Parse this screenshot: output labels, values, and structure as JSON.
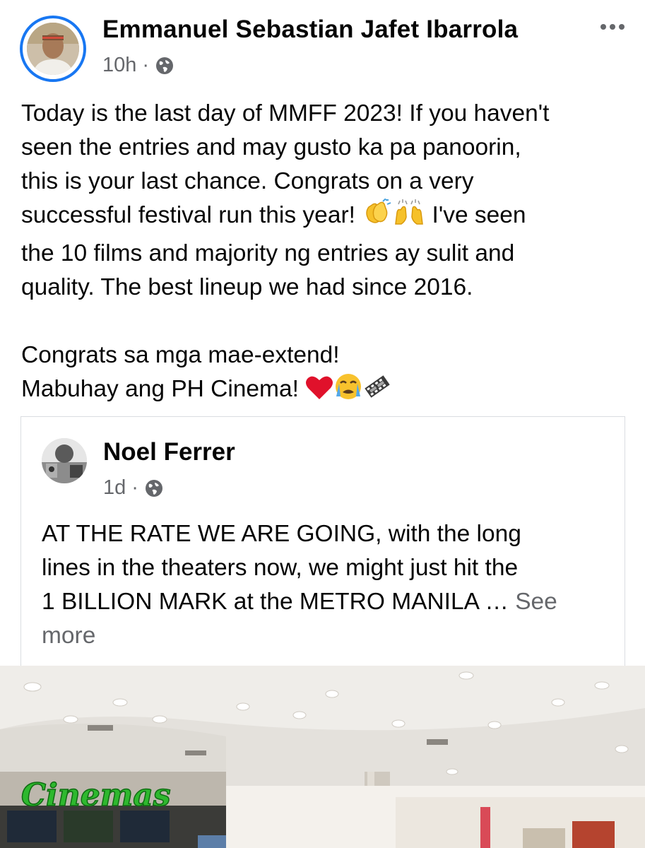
{
  "post": {
    "author_name": "Emmanuel Sebastian Jafet Ibarrola",
    "time": "10h",
    "separator": "·",
    "audience_icon": "globe-icon",
    "more_icon": "more-options-icon",
    "text_lines": [
      "Today is the last day of MMFF 2023! If you haven't",
      "seen the entries and may gusto ka pa panoorin,",
      "this is your last chance. Congrats on a very",
      "successful festival run this year! ",
      " I've seen",
      "the 10 films and majority ng entries ay sulit and",
      "quality. The best lineup we had since 2016.",
      "Congrats sa mga mae-extend!",
      "Mabuhay ang PH Cinema! "
    ],
    "emojis": {
      "line4": [
        "clapping-hands-emoji",
        "raising-hands-emoji"
      ],
      "line9": [
        "red-heart-emoji",
        "crying-face-emoji",
        "film-frames-emoji"
      ]
    }
  },
  "shared_post": {
    "author_name": "Noel Ferrer",
    "time": "1d",
    "separator": "·",
    "audience_icon": "globe-icon",
    "text_lines": [
      "AT THE RATE WE ARE GOING, with the long",
      "lines in the theaters now, we might just hit the",
      "1 BILLION MARK at the METRO MANILA … "
    ],
    "see_more_part1": "See",
    "see_more_part2": "more"
  },
  "photo": {
    "sign_text": "Cinemas",
    "accent_color": "#2eb82e"
  },
  "colors": {
    "ring": "#1877f2",
    "text": "#050505",
    "muted": "#65676b",
    "border": "#dadde1"
  }
}
